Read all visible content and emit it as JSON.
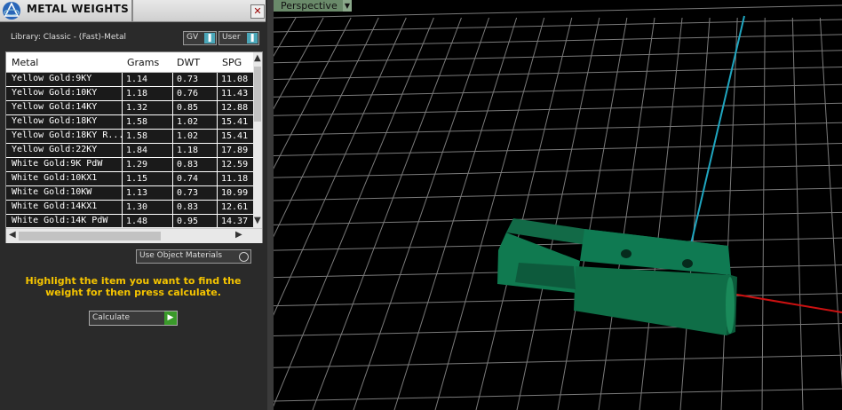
{
  "panel": {
    "title": "METAL WEIGHTS",
    "close_label": "✕",
    "library_label": "Library: Classic - (Fast)-Metal",
    "toggle_gv": "GV",
    "toggle_user": "User",
    "columns": [
      "Metal",
      "Grams",
      "DWT",
      "SPG"
    ],
    "rows": [
      {
        "metal": "Yellow Gold:9KY",
        "grams": "1.14",
        "dwt": "0.73",
        "spg": "11.08"
      },
      {
        "metal": "Yellow Gold:10KY",
        "grams": "1.18",
        "dwt": "0.76",
        "spg": "11.43"
      },
      {
        "metal": "Yellow Gold:14KY",
        "grams": "1.32",
        "dwt": "0.85",
        "spg": "12.88"
      },
      {
        "metal": "Yellow Gold:18KY",
        "grams": "1.58",
        "dwt": "1.02",
        "spg": "15.41"
      },
      {
        "metal": "Yellow Gold:18KY R...",
        "grams": "1.58",
        "dwt": "1.02",
        "spg": "15.41"
      },
      {
        "metal": "Yellow Gold:22KY",
        "grams": "1.84",
        "dwt": "1.18",
        "spg": "17.89"
      },
      {
        "metal": "White Gold:9K PdW",
        "grams": "1.29",
        "dwt": "0.83",
        "spg": "12.59"
      },
      {
        "metal": "White Gold:10KX1",
        "grams": "1.15",
        "dwt": "0.74",
        "spg": "11.18"
      },
      {
        "metal": "White Gold:10KW",
        "grams": "1.13",
        "dwt": "0.73",
        "spg": "10.99"
      },
      {
        "metal": "White Gold:14KX1",
        "grams": "1.30",
        "dwt": "0.83",
        "spg": "12.61"
      },
      {
        "metal": "White Gold:14K PdW",
        "grams": "1.48",
        "dwt": "0.95",
        "spg": "14.37"
      }
    ],
    "use_object_materials": "Use Object Materials",
    "message": "Highlight the item you want to find the weight for then press calculate.",
    "calculate_label": "Calculate"
  },
  "viewport": {
    "label": "Perspective",
    "colors": {
      "grid": "#808080",
      "y_axis": "#1fa6c0",
      "x_axis": "#cc1111",
      "object": "#0f6e47"
    }
  }
}
